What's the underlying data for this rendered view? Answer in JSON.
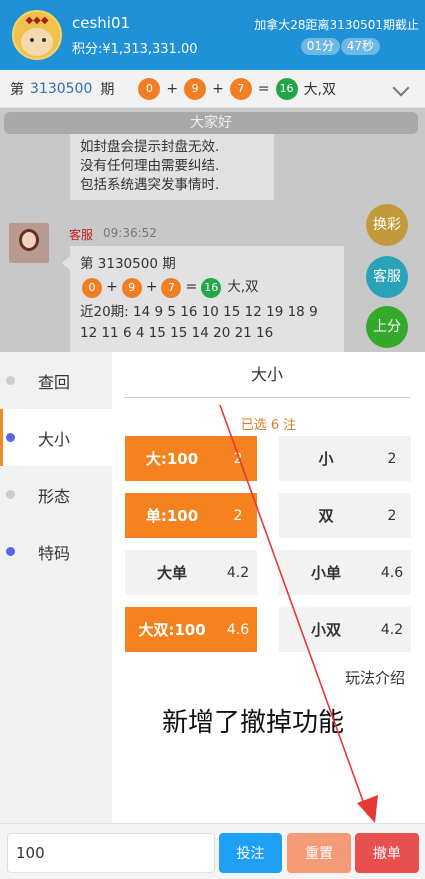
{
  "header": {
    "username": "ceshi01",
    "points": "积分:¥1,313,331.00",
    "period_text": "加拿大28距离3130501期截止",
    "timer_min": "01分",
    "timer_sec": "47秒"
  },
  "result": {
    "prefix": "第",
    "period": "3130500",
    "suffix": "期",
    "balls": [
      "0",
      "9",
      "7"
    ],
    "plus": "+",
    "equals": "=",
    "sum": "16",
    "outcome": "大,双"
  },
  "chat": {
    "notice": "大家好",
    "msg1_lines": [
      "如封盘会提示封盘无效.",
      "没有任何理由需要纠结.",
      "包括系统遇突发事情时."
    ],
    "cs_name": "客服",
    "cs_time": "09:36:52",
    "msg2_title": "第 3130500 期",
    "msg2_balls": [
      "0",
      "9",
      "7"
    ],
    "msg2_sum": "16",
    "msg2_outcome": "大,双",
    "msg2_history_1": "近20期: 14 9 5 16 10 15 12 19 18 9",
    "msg2_history_2": "12 11 6 4 15 15 14 20 21 16",
    "float_buttons": [
      "换彩",
      "客服",
      "上分"
    ]
  },
  "menu": {
    "items": [
      {
        "label": "查回",
        "dot": "gray"
      },
      {
        "label": "大小",
        "dot": "blue",
        "active": true
      },
      {
        "label": "形态",
        "dot": "gray"
      },
      {
        "label": "特码",
        "dot": "blue"
      }
    ]
  },
  "bets": {
    "tab_title": "大小",
    "selected_text": "已选 6 注",
    "options": [
      {
        "name": "大:100",
        "odds": "2",
        "on": true
      },
      {
        "name": "小",
        "odds": "2",
        "on": false
      },
      {
        "name": "单:100",
        "odds": "2",
        "on": true
      },
      {
        "name": "双",
        "odds": "2",
        "on": false
      },
      {
        "name": "大单",
        "odds": "4.2",
        "on": false
      },
      {
        "name": "小单",
        "odds": "4.6",
        "on": false
      },
      {
        "name": "大双:100",
        "odds": "4.6",
        "on": true
      },
      {
        "name": "小双",
        "odds": "4.2",
        "on": false
      }
    ],
    "rule_link": "玩法介绍",
    "annotation": "新增了撤掉功能"
  },
  "bottom": {
    "amount": "100",
    "bet_label": "投注",
    "reset_label": "重置",
    "cancel_label": "撤单"
  },
  "colors": {
    "header_blue": "#1f8fd6",
    "ball_orange": "#f07f24",
    "ball_green": "#23a548",
    "selected_orange": "#f5821f",
    "bet_blue": "#1ea1f5",
    "reset_salmon": "#f49a76",
    "cancel_red": "#e84f4f",
    "annotation_red": "#e53935"
  }
}
